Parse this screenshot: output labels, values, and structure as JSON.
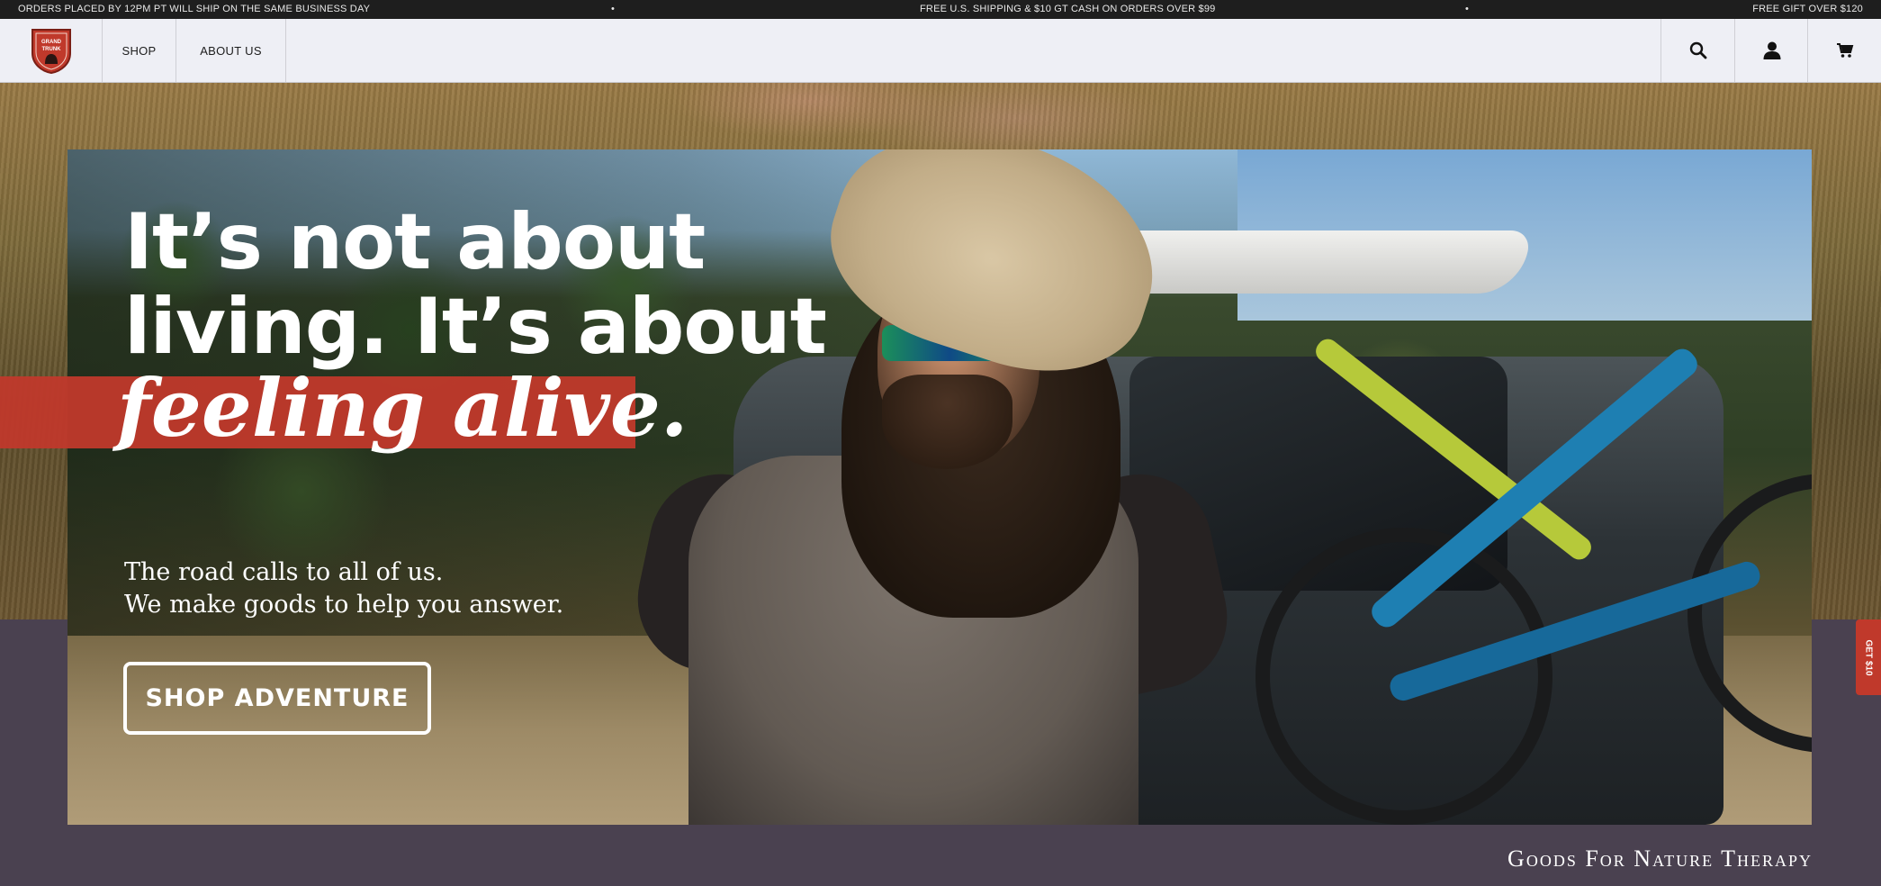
{
  "announcement": {
    "left": "ORDERS PLACED BY 12PM PT WILL SHIP ON THE SAME BUSINESS DAY",
    "separator": "•",
    "center": "FREE U.S. SHIPPING & $10 GT CASH ON ORDERS OVER $99",
    "right": "FREE GIFT OVER $120"
  },
  "header": {
    "logo_text_1": "GRAND",
    "logo_text_2": "TRUNK",
    "nav": [
      {
        "label": "SHOP"
      },
      {
        "label": "ABOUT US"
      }
    ],
    "icons": [
      "search-icon",
      "account-icon",
      "cart-icon"
    ]
  },
  "hero": {
    "headline_line1": "It’s not about",
    "headline_line2": "living. It’s about",
    "headline_italic": "feeling alive.",
    "sub_line1": "The road calls to all of us.",
    "sub_line2": "We make goods to help you answer.",
    "cta_label": "SHOP ADVENTURE",
    "tagline": "Goods For Nature Therapy"
  },
  "side_tab": {
    "label": "GET $10"
  },
  "colors": {
    "accent_red": "#c0392b",
    "announce_bg": "#1e1e1e",
    "header_bg": "#eeeff5",
    "band_purple": "#4a4150"
  }
}
